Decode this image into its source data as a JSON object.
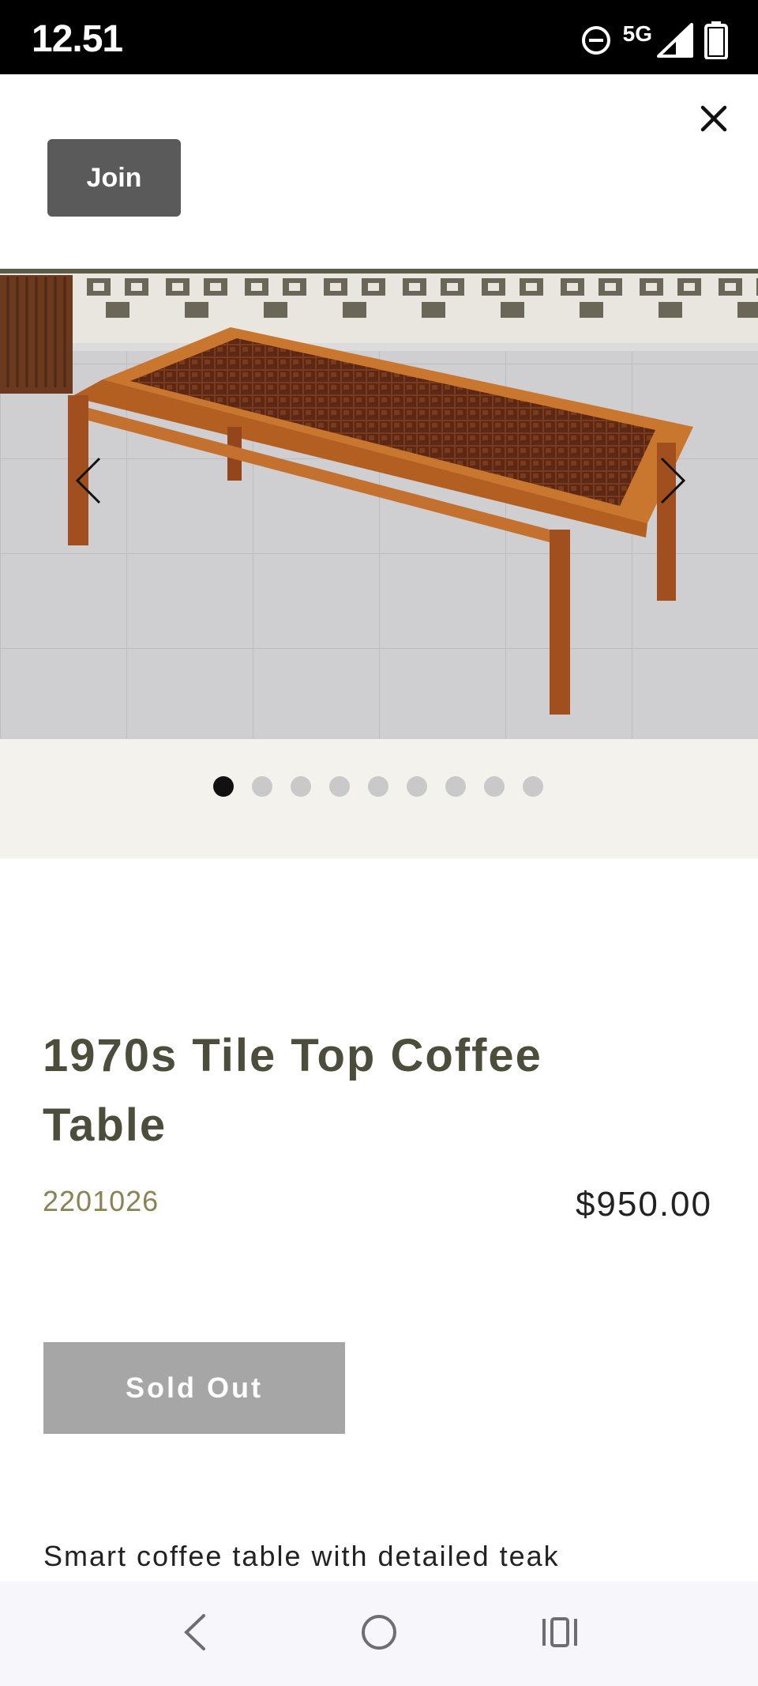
{
  "status_bar": {
    "time": "12.51",
    "network": "5G",
    "icons": [
      "do-not-disturb-icon",
      "signal-icon",
      "battery-icon"
    ]
  },
  "header": {
    "join_label": "Join",
    "close_icon": "close-icon"
  },
  "gallery": {
    "image_count": 9,
    "active_index": 0,
    "prev_icon": "chevron-left-icon",
    "next_icon": "chevron-right-icon",
    "background": "#f4f2ec"
  },
  "product": {
    "title": "1970s Tile Top Coffee Table",
    "sku": "2201026",
    "price": "$950.00",
    "cta_label": "Sold Out",
    "description_start": "Smart coffee table with detailed teak"
  },
  "colors": {
    "title": "#4d4d3c",
    "sku": "#8a8455",
    "join_bg": "#5a5a5a",
    "sold_out_bg": "#a6a6a6"
  },
  "system_nav": {
    "icons": [
      "back-icon",
      "home-icon",
      "recents-icon"
    ]
  }
}
